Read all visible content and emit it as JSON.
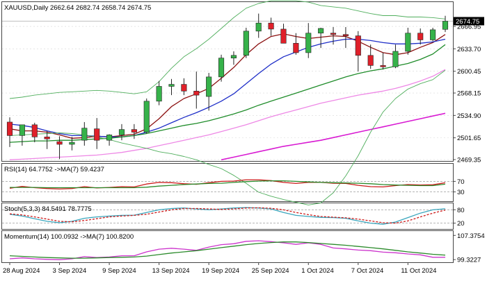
{
  "colors": {
    "bull": "#36b24a",
    "bear": "#e0202a",
    "sma_fast": "#8b1010",
    "sma_mid": "#1e2ec8",
    "sma_slow": "#1f8c2a",
    "sma_pink": "#ee88e6",
    "sma_magenta": "#d81ad2",
    "bollinger": "#4fae5c",
    "rsi": "#cc1a1a",
    "rsi_ma": "#2a8a2a",
    "stoch_k": "#3aa6bd",
    "stoch_d": "#cc1a1a",
    "momentum": "#cc33cc",
    "momentum_ma": "#2a8a2a",
    "last_price_bg": "#000000",
    "last_price_fg": "#ffffff",
    "grid": "#d8d8d8",
    "frame": "#444444"
  },
  "main": {
    "legend": "XAUUSD,Daily 2662.64 2682.74 2658.74 2674.75",
    "last_price_label": "2674.75"
  },
  "rsi": {
    "legend": "RSI(14) 64.7752 ->MA(7) 59.4237"
  },
  "stoch": {
    "legend": "Stoch(5,3,3) 84.5491 78.7775"
  },
  "momentum": {
    "legend": "Momentum(14) 100.0932 ->MA(7) 100.8200"
  },
  "chart_data": [
    {
      "type": "candlestick",
      "title": "XAUUSD,Daily",
      "dates": [
        "2024-08-28",
        "2024-08-29",
        "2024-08-30",
        "2024-09-02",
        "2024-09-03",
        "2024-09-04",
        "2024-09-05",
        "2024-09-06",
        "2024-09-09",
        "2024-09-10",
        "2024-09-11",
        "2024-09-12",
        "2024-09-13",
        "2024-09-16",
        "2024-09-17",
        "2024-09-18",
        "2024-09-19",
        "2024-09-20",
        "2024-09-23",
        "2024-09-24",
        "2024-09-25",
        "2024-09-26",
        "2024-09-27",
        "2024-09-30",
        "2024-10-01",
        "2024-10-02",
        "2024-10-03",
        "2024-10-04",
        "2024-10-07",
        "2024-10-08",
        "2024-10-09",
        "2024-10-10",
        "2024-10-11",
        "2024-10-14",
        "2024-10-15",
        "2024-10-16"
      ],
      "open": [
        2525,
        2505,
        2521,
        2503,
        2496,
        2492,
        2498,
        2515,
        2498,
        2506,
        2514,
        2510,
        2556,
        2578,
        2581,
        2571,
        2563,
        2592,
        2620,
        2624,
        2660,
        2672,
        2663,
        2642,
        2628,
        2657,
        2657,
        2655,
        2653,
        2624,
        2609,
        2607,
        2630,
        2657,
        2647,
        2662.64
      ],
      "high": [
        2532,
        2516,
        2524,
        2512,
        2504,
        2503,
        2525,
        2531,
        2507,
        2522,
        2522,
        2560,
        2586,
        2589,
        2590,
        2600,
        2598,
        2625,
        2630,
        2665,
        2686,
        2680,
        2671,
        2657,
        2672,
        2665,
        2666,
        2666,
        2660,
        2640,
        2628,
        2640,
        2665,
        2664,
        2665,
        2682.74
      ],
      "low": [
        2488,
        2490,
        2495,
        2485,
        2470,
        2483,
        2490,
        2485,
        2490,
        2498,
        2500,
        2508,
        2550,
        2565,
        2565,
        2545,
        2542,
        2585,
        2610,
        2620,
        2650,
        2653,
        2645,
        2625,
        2620,
        2635,
        2640,
        2635,
        2600,
        2604,
        2603,
        2605,
        2625,
        2640,
        2645,
        2658.74
      ],
      "close": [
        2505,
        2521,
        2503,
        2500,
        2492,
        2495,
        2516,
        2498,
        2506,
        2514,
        2510,
        2556,
        2578,
        2581,
        2571,
        2565,
        2592,
        2620,
        2624,
        2660,
        2672,
        2663,
        2642,
        2628,
        2657,
        2664,
        2655,
        2653,
        2624,
        2609,
        2607,
        2630,
        2657,
        2647,
        2662,
        2674.75
      ],
      "ylim": [
        2469.35,
        2700
      ],
      "y_ticks": [
        "2666.95",
        "2633.70",
        "2600.45",
        "2568.15",
        "2534.90",
        "2501.65",
        "2469.35"
      ],
      "x_ticks": [
        {
          "label": "28 Aug 2024",
          "index": 0
        },
        {
          "label": "3 Sep 2024",
          "index": 4
        },
        {
          "label": "9 Sep 2024",
          "index": 8
        },
        {
          "label": "13 Sep 2024",
          "index": 12
        },
        {
          "label": "19 Sep 2024",
          "index": 16
        },
        {
          "label": "25 Sep 2024",
          "index": 20
        },
        {
          "label": "1 Oct 2024",
          "index": 24
        },
        {
          "label": "7 Oct 2024",
          "index": 28
        },
        {
          "label": "11 Oct 2024",
          "index": 32
        }
      ],
      "last_price": 2674.75,
      "overlays": [
        {
          "color_key": "sma_fast",
          "values": [
            2515,
            2512,
            2512,
            2510,
            2506,
            2501,
            2502,
            2504,
            2503,
            2505,
            2507,
            2515,
            2530,
            2548,
            2560,
            2567,
            2575,
            2590,
            2606,
            2625,
            2641,
            2652,
            2656,
            2652,
            2649,
            2651,
            2653,
            2652,
            2645,
            2636,
            2628,
            2625,
            2628,
            2636,
            2643,
            2655
          ]
        },
        {
          "color_key": "sma_mid",
          "values": [
            2522,
            2520,
            2517,
            2512,
            2508,
            2505,
            2505,
            2504,
            2503,
            2503,
            2505,
            2510,
            2516,
            2524,
            2532,
            2539,
            2547,
            2556,
            2567,
            2582,
            2597,
            2611,
            2622,
            2629,
            2636,
            2641,
            2645,
            2648,
            2648,
            2646,
            2643,
            2641,
            2641,
            2642,
            2644,
            2648
          ]
        },
        {
          "color_key": "sma_slow",
          "values": [
            2495,
            2496,
            2497,
            2497,
            2498,
            2498,
            2499,
            2500,
            2501,
            2503,
            2505,
            2508,
            2512,
            2516,
            2520,
            2523,
            2527,
            2532,
            2537,
            2543,
            2550,
            2556,
            2562,
            2568,
            2574,
            2580,
            2586,
            2592,
            2597,
            2601,
            2604,
            2608,
            2612,
            2618,
            2626,
            2640
          ]
        },
        {
          "color_key": "sma_pink",
          "values": [
            2469,
            2470,
            2471,
            2472,
            2473,
            2474,
            2475,
            2476,
            2478,
            2480,
            2483,
            2486,
            2490,
            2494,
            2498,
            2502,
            2506,
            2511,
            2516,
            2521,
            2527,
            2533,
            2538,
            2543,
            2548,
            2553,
            2557,
            2561,
            2565,
            2568,
            2571,
            2575,
            2580,
            2586,
            2593,
            2603
          ]
        },
        {
          "color_key": "sma_magenta",
          "values": [
            null,
            null,
            null,
            null,
            null,
            null,
            null,
            null,
            null,
            null,
            null,
            null,
            null,
            null,
            null,
            null,
            null,
            2469,
            2473,
            2477,
            2481,
            2485,
            2489,
            2492,
            2495,
            2498,
            2502,
            2506,
            2510,
            2514,
            2518,
            2522,
            2526,
            2530,
            2534,
            2538
          ]
        },
        {
          "color_key": "bollinger",
          "values": [
            2560,
            2562,
            2565,
            2567,
            2569,
            2570,
            2571,
            2572,
            2571,
            2569,
            2567,
            2570,
            2585,
            2605,
            2622,
            2634,
            2648,
            2664,
            2680,
            2694,
            2701,
            2705,
            2705,
            2705,
            2703,
            2698,
            2696,
            2694,
            2690,
            2686,
            2683,
            2683,
            2681,
            2681,
            2680,
            2678
          ]
        },
        {
          "color_key": "bollinger",
          "values": [
            2505,
            2506,
            2507,
            2508,
            2509,
            2508,
            2506,
            2503,
            2499,
            2494,
            2490,
            2486,
            2481,
            2478,
            2474,
            2469,
            2462,
            2456,
            2446,
            2434,
            2421,
            2415,
            2410,
            2406,
            2402,
            2405,
            2420,
            2445,
            2475,
            2510,
            2540,
            2560,
            2574,
            2582,
            2588,
            2602
          ]
        }
      ]
    },
    {
      "type": "line",
      "title": "RSI(14)",
      "y_ticks": [
        "70",
        "30"
      ],
      "reference_lines": [
        70,
        30
      ],
      "ylim": [
        0,
        100
      ],
      "series": [
        {
          "name": "RSI(14)",
          "color_key": "rsi",
          "values": [
            44,
            51,
            46,
            43,
            41,
            43,
            50,
            45,
            47,
            50,
            49,
            60,
            66,
            65,
            61,
            59,
            65,
            70,
            71,
            76,
            76,
            73,
            66,
            62,
            66,
            66,
            63,
            62,
            55,
            50,
            49,
            54,
            58,
            56,
            57,
            64.7752
          ]
        },
        {
          "name": "MA(7)",
          "color_key": "rsi_ma",
          "values": [
            47,
            47,
            47,
            46,
            46,
            46,
            46,
            46,
            46,
            46,
            46,
            48,
            52,
            55,
            58,
            60,
            62,
            63,
            66,
            69,
            71,
            72,
            72,
            70,
            68,
            66,
            65,
            64,
            63,
            61,
            58,
            56,
            55,
            54,
            54,
            59.4237
          ]
        }
      ]
    },
    {
      "type": "line",
      "title": "Stoch(5,3,3)",
      "y_ticks": [
        "80",
        "20"
      ],
      "reference_lines": [
        80,
        20
      ],
      "ylim": [
        0,
        100
      ],
      "series": [
        {
          "name": "%K",
          "color_key": "stoch_k",
          "values": [
            60,
            52,
            40,
            28,
            22,
            28,
            42,
            48,
            52,
            55,
            56,
            68,
            80,
            86,
            88,
            84,
            80,
            84,
            88,
            90,
            88,
            84,
            68,
            55,
            50,
            46,
            45,
            42,
            30,
            20,
            15,
            25,
            45,
            65,
            80,
            84.5491
          ]
        },
        {
          "name": "%D",
          "color_key": "stoch_d",
          "values": [
            62,
            57,
            48,
            38,
            28,
            26,
            32,
            40,
            48,
            52,
            55,
            60,
            70,
            80,
            86,
            86,
            84,
            82,
            84,
            88,
            89,
            87,
            80,
            68,
            58,
            50,
            47,
            44,
            38,
            30,
            22,
            20,
            30,
            48,
            65,
            78.7775
          ]
        }
      ]
    },
    {
      "type": "line",
      "title": "Momentum(14)",
      "y_ticks": [
        "107.3754",
        "99.3227"
      ],
      "ylim": [
        98.9,
        107.9
      ],
      "series": [
        {
          "name": "Momentum(14)",
          "color_key": "momentum",
          "values": [
            99.6,
            99.9,
            99.6,
            99.4,
            99.3,
            99.6,
            100.3,
            100.0,
            100.2,
            100.6,
            100.6,
            101.9,
            102.8,
            103.1,
            102.8,
            102.4,
            103.5,
            104.3,
            104.6,
            105.4,
            105.6,
            105.3,
            104.9,
            104.4,
            104.9,
            104.4,
            103.2,
            102.9,
            102.5,
            102.3,
            101.8,
            101.6,
            101.2,
            100.9,
            100.1,
            100.0932
          ]
        },
        {
          "name": "MA(7)",
          "color_key": "momentum_ma",
          "values": [
            100.6,
            100.4,
            100.2,
            100.0,
            99.9,
            99.8,
            99.8,
            99.9,
            100.0,
            100.1,
            100.2,
            100.5,
            101.0,
            101.5,
            101.9,
            102.3,
            102.8,
            103.3,
            103.8,
            104.3,
            104.7,
            105.0,
            105.2,
            105.2,
            105.0,
            104.7,
            104.4,
            104.1,
            103.7,
            103.3,
            102.9,
            102.4,
            101.9,
            101.5,
            101.1,
            100.82
          ]
        }
      ]
    }
  ]
}
